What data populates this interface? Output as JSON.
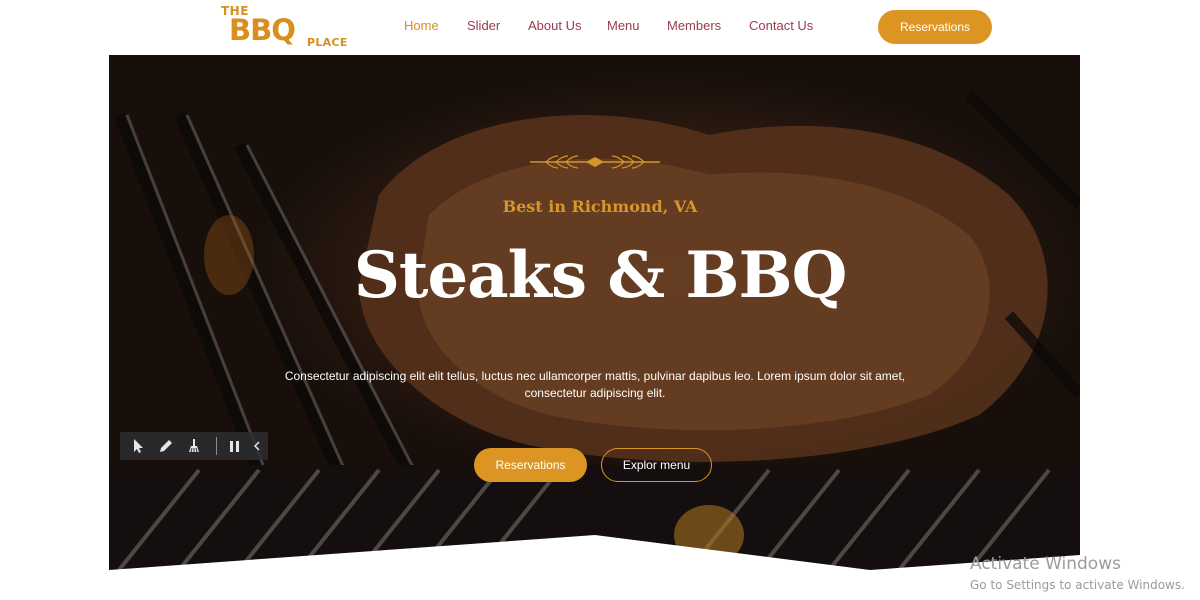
{
  "brand": {
    "logo_the": "THE",
    "logo_bbq": "BBQ",
    "logo_place": "PLACE",
    "accent_color": "#dc9523"
  },
  "nav": {
    "items": [
      {
        "label": "Home",
        "active": true
      },
      {
        "label": "Slider",
        "active": false
      },
      {
        "label": "About Us",
        "active": false
      },
      {
        "label": "Menu",
        "active": false
      },
      {
        "label": "Members",
        "active": false
      },
      {
        "label": "Contact Us",
        "active": false
      }
    ],
    "reservations_label": "Reservations"
  },
  "hero": {
    "kicker": "Best in Richmond, VA",
    "title": "Steaks & BBQ",
    "description": "Consectetur adipiscing elit elit tellus, luctus nec ullamcorper mattis, pulvinar dapibus leo. Lorem ipsum dolor sit amet, consectetur adipiscing elit.",
    "primary_button": "Reservations",
    "secondary_button": "Explor menu"
  },
  "toolbar": {
    "tools": [
      "cursor-icon",
      "pencil-icon",
      "broom-icon",
      "pause-icon",
      "chevron-left-icon"
    ]
  },
  "watermark": {
    "title": "Activate Windows",
    "subtitle": "Go to Settings to activate Windows."
  }
}
